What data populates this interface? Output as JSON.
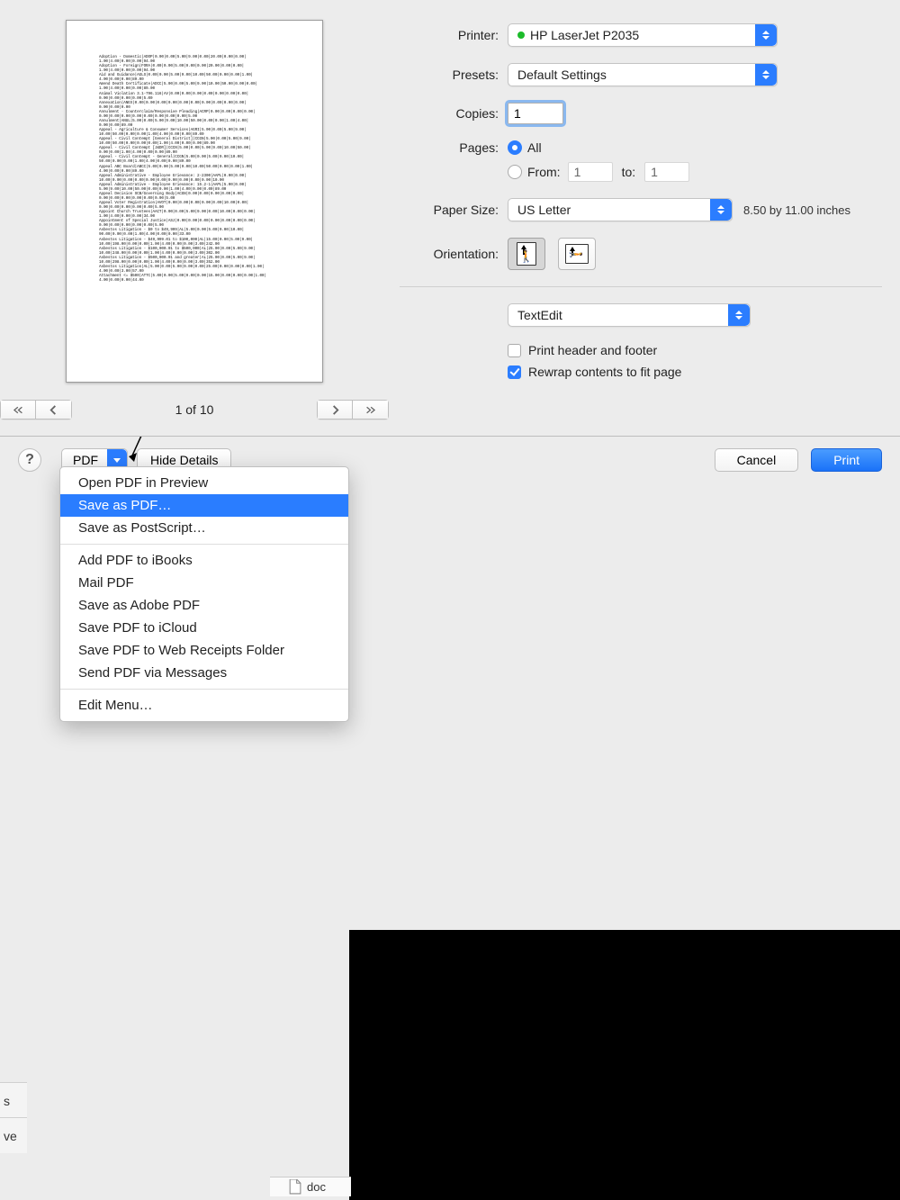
{
  "domain": "Computer-Use",
  "preview": {
    "page_indicator": "1 of 10",
    "lines": [
      "Adoption - Domestic|ADOP|0.00|0.00|5.00|9.00|0.00|20.00|0.00|0.00|",
      "1.00|4.00|0.00|0.00|94.00",
      "Adoption - Foreign|FORA|0.00|0.00|5.00|9.00|0.00|20.00|0.00|0.00|",
      "1.00|4.00|0.00|0.00|94.00",
      "Aid and Guidance|AGLS|0.00|0.00|5.00|9.00|10.00|50.00|0.00|0.00|1.00|",
      "4.00|0.00|0.00|89.00",
      "Amend Death Certificate|ADCC|5.00|0.00|5.00|9.00|10.00|50.00|0.00|0.00|",
      "1.00|4.00|0.00|0.00|89.00",
      "Animal Violation 3.1-796.116|AV|0.00|0.00|0.00|0.00|0.00|0.00|0.00|",
      "0.00|0.00|0.00|0.00|5.00",
      "Annexation|ANEX|0.00|0.00|0.00|0.00|0.00|0.00|0.00|0.00|0.00|0.00|",
      "0.00|0.00|0.00",
      "Annulment - Counterclaim/Responsive Pleading|ACRP|0.00|0.00|0.00|0.00|",
      "0.00|0.00|0.00|0.00|0.00|0.00|0.00|0.00|5.00",
      "Annulment|ANUL|5.00|0.00|5.00|9.00|10.00|50.00|0.00|0.00|1.00|4.00|",
      "0.00|0.00|89.00",
      "Appeal - Agriculture & Consumer Services|AGRI|5.00|0.00|5.00|9.00|",
      "10.00|50.00|0.00|0.00|1.00|4.00|0.00|0.00|89.00",
      "Appeal - Civil Contempt [General District]|CCGN|5.00|0.00|5.00|9.00|",
      "10.00|50.00|0.00|0.00|0.00|1.00|4.00|0.00|0.00|89.00",
      "Appeal - Civil Contempt [J&DR]|CCCN|5.00|0.00|5.00|9.00|10.00|50.00|",
      "0.00|0.00|1.00|4.00|0.00|0.00|89.00",
      "Appeal - Civil Contempt - General|CCGN|5.00|0.00|5.00|9.00|10.00|",
      "50.00|0.00|0.00|1.00|4.00|0.00|0.00|89.00",
      "Appeal ABC Board|ABCC|5.00|0.00|5.00|9.00|10.00|50.00|0.00|0.00|1.00|",
      "4.00|0.00|0.00|89.00",
      "Appeal Administrative - Employee Grievance: 2-2300|AAPL|0.00|0.00|",
      "10.00|0.00|0.00|0.00|0.00|0.00|0.00|0.00|0.00|0.00|10.00",
      "Appeal Administrative - Employee Grievance: 15.2-1|AAPL|5.00|0.00|",
      "5.00|9.00|10.00|50.00|0.00|0.00|1.00|4.00|0.00|0.00|89.00",
      "Appeal Decision SCB/Governing Body|ACGN|0.00|0.00|0.00|0.00|0.00|",
      "0.00|0.00|0.00|0.00|0.00|0.00|5.00",
      "Appeal Voter Registration|AVOT|0.00|0.00|0.00|0.00|0.00|10.00|0.00|",
      "0.00|0.00|0.00|0.00|0.00|5.00",
      "Appoint Church Trustees|AACT|0.00|0.00|5.00|9.00|0.00|10.00|0.00|0.00|",
      "1.00|4.00|0.00|0.00|34.00",
      "Appointment of Special Justice|ASJ|0.00|0.00|0.00|0.00|0.00|0.00|0.00|",
      "0.00|0.00|0.00|0.00|0.00|5.00",
      "Asbestos Litigation - $0 to $49,999|AL|5.00|0.00|5.00|9.00|10.00|",
      "90.00|0.00|0.00|1.00|4.00|0.00|0.00|33.00",
      "Asbestos Litigation - $49,999.01 to $100,000|AL|15.00|0.00|5.00|9.00|",
      "10.00|198.00|0.00|0.00|1.00|4.00|0.00|0.00|3.00|242.00",
      "Asbestos Litigation - $100,000.01 to $500,000|AL|25.00|0.00|5.00|9.00|",
      "10.00|248.00|0.00|0.00|1.00|4.00|0.00|0.00|3.00|302.00",
      "Asbestos Litigation - $500,000.01 and greater|AL|25.00|0.00|5.00|9.00|",
      "10.00|298.00|0.00|0.00|1.00|4.00|0.00|0.00|3.00|352.00",
      "Asbestos Litigation|AL|5.00|0.00|5.00|9.00|0.00|25.00|0.00|0.00|0.00|1.00|",
      "4.00|0.00|3.00|57.00",
      "Attachment <= $500|ATTC|5.00|0.00|5.00|9.00|0.00|15.00|0.00|0.00|0.00|1.00|",
      "4.00|0.00|0.00|44.00"
    ]
  },
  "settings": {
    "printer": {
      "label": "Printer:",
      "value": "HP LaserJet P2035",
      "dot_color": "#1cbb2a"
    },
    "presets": {
      "label": "Presets:",
      "value": "Default Settings"
    },
    "copies": {
      "label": "Copies:",
      "value": "1"
    },
    "pages": {
      "label": "Pages:",
      "all_label": "All",
      "from_label": "From:",
      "to_label": "to:",
      "from_value": "1",
      "to_value": "1",
      "selected": "all"
    },
    "paper_size": {
      "label": "Paper Size:",
      "value": "US Letter",
      "info": "8.50 by 11.00 inches"
    },
    "orientation": {
      "label": "Orientation:"
    },
    "app_select": {
      "value": "TextEdit"
    },
    "opt_header": {
      "label": "Print header and footer",
      "checked": false
    },
    "opt_rewrap": {
      "label": "Rewrap contents to fit page",
      "checked": true
    }
  },
  "toolbar": {
    "pdf_label": "PDF",
    "hide_label": "Hide Details",
    "cancel_label": "Cancel",
    "print_label": "Print"
  },
  "menu": {
    "items": [
      {
        "label": "Open PDF in Preview",
        "highlight": false
      },
      {
        "label": "Save as PDF…",
        "highlight": true
      },
      {
        "label": "Save as PostScript…",
        "highlight": false
      }
    ],
    "items2": [
      {
        "label": "Add PDF to iBooks"
      },
      {
        "label": "Mail PDF"
      },
      {
        "label": "Save as Adobe PDF"
      },
      {
        "label": "Save PDF to iCloud"
      },
      {
        "label": "Save PDF to Web Receipts Folder"
      },
      {
        "label": "Send PDF via Messages"
      }
    ],
    "edit_label": "Edit Menu…"
  },
  "behind": {
    "stub1": "s",
    "stub2": "ve",
    "file_stub": "doc"
  }
}
